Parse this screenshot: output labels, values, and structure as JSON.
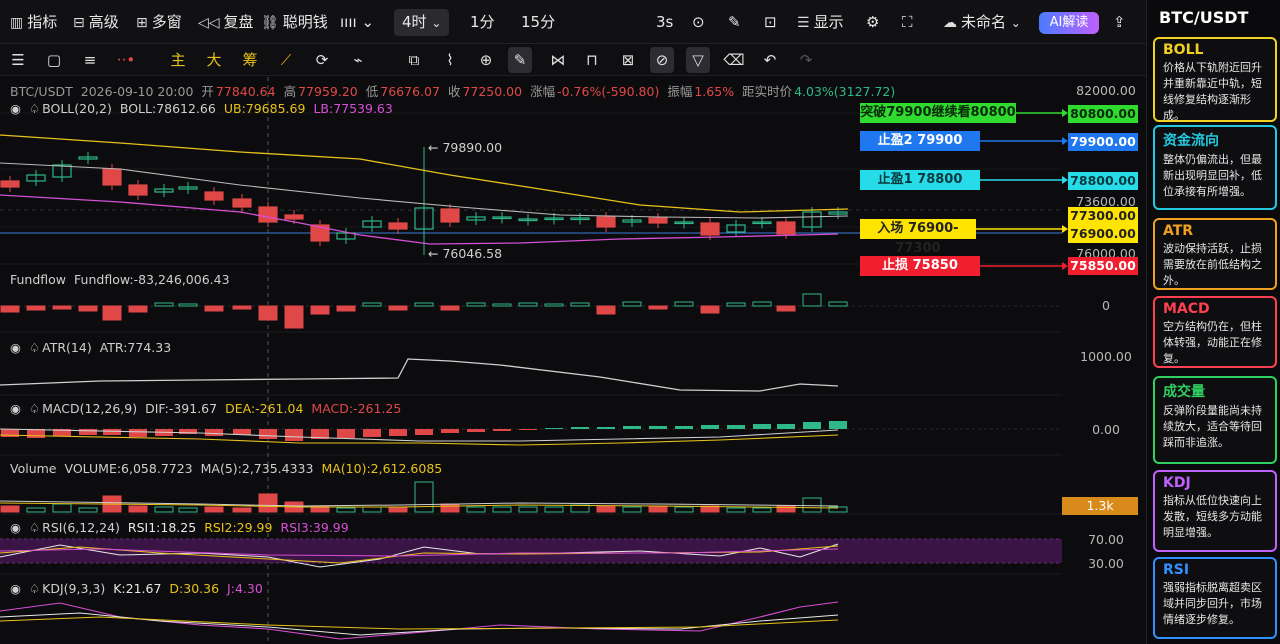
{
  "topbar": {
    "indicators": "指标",
    "advanced": "高级",
    "multiwin": "多窗",
    "replay": "复盘",
    "smart_money": "聪明钱",
    "tf_active": "4时",
    "tf_1m": "1分",
    "tf_15m": "15分",
    "refresh": "3s",
    "display": "显示",
    "layout_name": "未命名",
    "ai": "AI解读"
  },
  "toolbar": {
    "main": "主",
    "big": "大",
    "chips": "筹"
  },
  "header": {
    "symbol": "BTC/USDT",
    "time": "2026-09-10 20:00",
    "open_l": "开",
    "open": "77840.64",
    "high_l": "高",
    "high": "77959.20",
    "low_l": "低",
    "low": "76676.07",
    "close_l": "收",
    "close": "77250.00",
    "chg_l": "涨幅",
    "chg": "-0.76%(-590.80)",
    "amp_l": "振幅",
    "amp": "1.65%",
    "dist_l": "距实时价",
    "dist": "4.03%(3127.72)"
  },
  "boll": {
    "name": "BOLL(20,2)",
    "mid": "BOLL:78612.66",
    "ub": "UB:79685.69",
    "lb": "LB:77539.63"
  },
  "markers": {
    "high": "← 79890.00",
    "low": "← 76046.58"
  },
  "annotations": {
    "breakout": "突破79900继续看80800",
    "tp2": "止盈2  79900",
    "tp1": "止盈1  78800",
    "entry": "入场 76900-77300",
    "stop": "止损  75850"
  },
  "price_axis": {
    "t1": "82000.00",
    "t2": "73600.00",
    "t3": "76000.00",
    "p_breakout": "80800.00",
    "p_tp2": "79900.00",
    "p_tp1": "78800.00",
    "p_e1": "77300.00",
    "p_e2": "76900.00",
    "p_stop": "75850.00"
  },
  "fundflow": {
    "name": "Fundflow",
    "value": "Fundflow:-83,246,006.43",
    "axis": "0"
  },
  "atr": {
    "name": "ATR(14)",
    "value": "ATR:774.33",
    "axis": "1000.00"
  },
  "macd": {
    "name": "MACD(12,26,9)",
    "dif": "DIF:-391.67",
    "dea": "DEA:-261.04",
    "macd": "MACD:-261.25",
    "axis": "0.00"
  },
  "volume": {
    "name": "Volume",
    "value": "VOLUME:6,058.7723",
    "ma5": "MA(5):2,735.4333",
    "ma10": "MA(10):2,612.6085",
    "axis": "1.3k"
  },
  "rsi": {
    "name": "RSI(6,12,24)",
    "r1": "RSI1:18.25",
    "r2": "RSI2:29.99",
    "r3": "RSI3:39.99",
    "a1": "70.00",
    "a2": "30.00"
  },
  "kdj": {
    "name": "KDJ(9,3,3)",
    "k": "K:21.67",
    "d": "D:30.36",
    "j": "J:4.30"
  },
  "side": {
    "title": "BTC/USDT",
    "cards": [
      {
        "t": "BOLL",
        "d": "价格从下轨附近回升并重新靠近中轨，短线修复结构逐渐形成。"
      },
      {
        "t": "资金流向",
        "d": "整体仍偏流出，但最新出现明显回补，低位承接有所增强。"
      },
      {
        "t": "ATR",
        "d": "波动保持活跃，止损需要放在前低结构之外。"
      },
      {
        "t": "MACD",
        "d": "空方结构仍在，但柱体转强，动能正在修复。"
      },
      {
        "t": "成交量",
        "d": "反弹阶段量能尚未持续放大，适合等待回踩而非追涨。"
      },
      {
        "t": "KDJ",
        "d": "指标从低位快速向上发散，短线多方动能明显增强。"
      },
      {
        "t": "RSI",
        "d": "强弱指标脱离超卖区域并同步回升，市场情绪逐步修复。"
      }
    ]
  },
  "colors": {
    "up": "#e04848",
    "down": "#2fb88a",
    "boll_ub": "#e8c21a",
    "boll_lb": "#d64fd6",
    "boll_mid": "#bbbbbb"
  }
}
